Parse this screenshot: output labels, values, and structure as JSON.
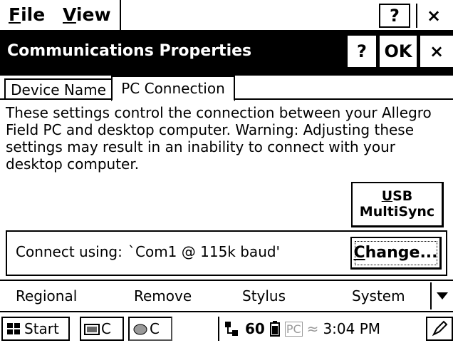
{
  "menubar": {
    "file_label": "File",
    "file_mnemonic": "F",
    "view_label": "View",
    "view_mnemonic": "V",
    "help_label": "?",
    "close_label": "×"
  },
  "dialog": {
    "title": "Communications Properties",
    "help_label": "?",
    "ok_label": "OK",
    "close_label": "×"
  },
  "tabs": [
    {
      "label": "Device Name",
      "selected": false
    },
    {
      "label": "PC Connection",
      "selected": true
    }
  ],
  "description": "These settings control the connection between your Allegro Field PC and desktop computer.  Warning: Adjusting these settings may result in an inability to connect with your desktop computer.",
  "usb_button": {
    "line1": "USB",
    "line2": "MultiSync"
  },
  "connection": {
    "label": "Connect using:",
    "value": "`Com1 @ 115k baud'",
    "change_label": "Change..."
  },
  "command_bar": {
    "items": [
      "Regional",
      "Remove",
      "Stylus",
      "System"
    ]
  },
  "taskbar": {
    "start_label": "Start",
    "task1_label": "C",
    "task2_label": "C",
    "time": "3:04 PM",
    "tray_icons": [
      "network-icon",
      "sync-icon",
      "power-icon",
      "pc-icon",
      "wireless-icon"
    ]
  }
}
